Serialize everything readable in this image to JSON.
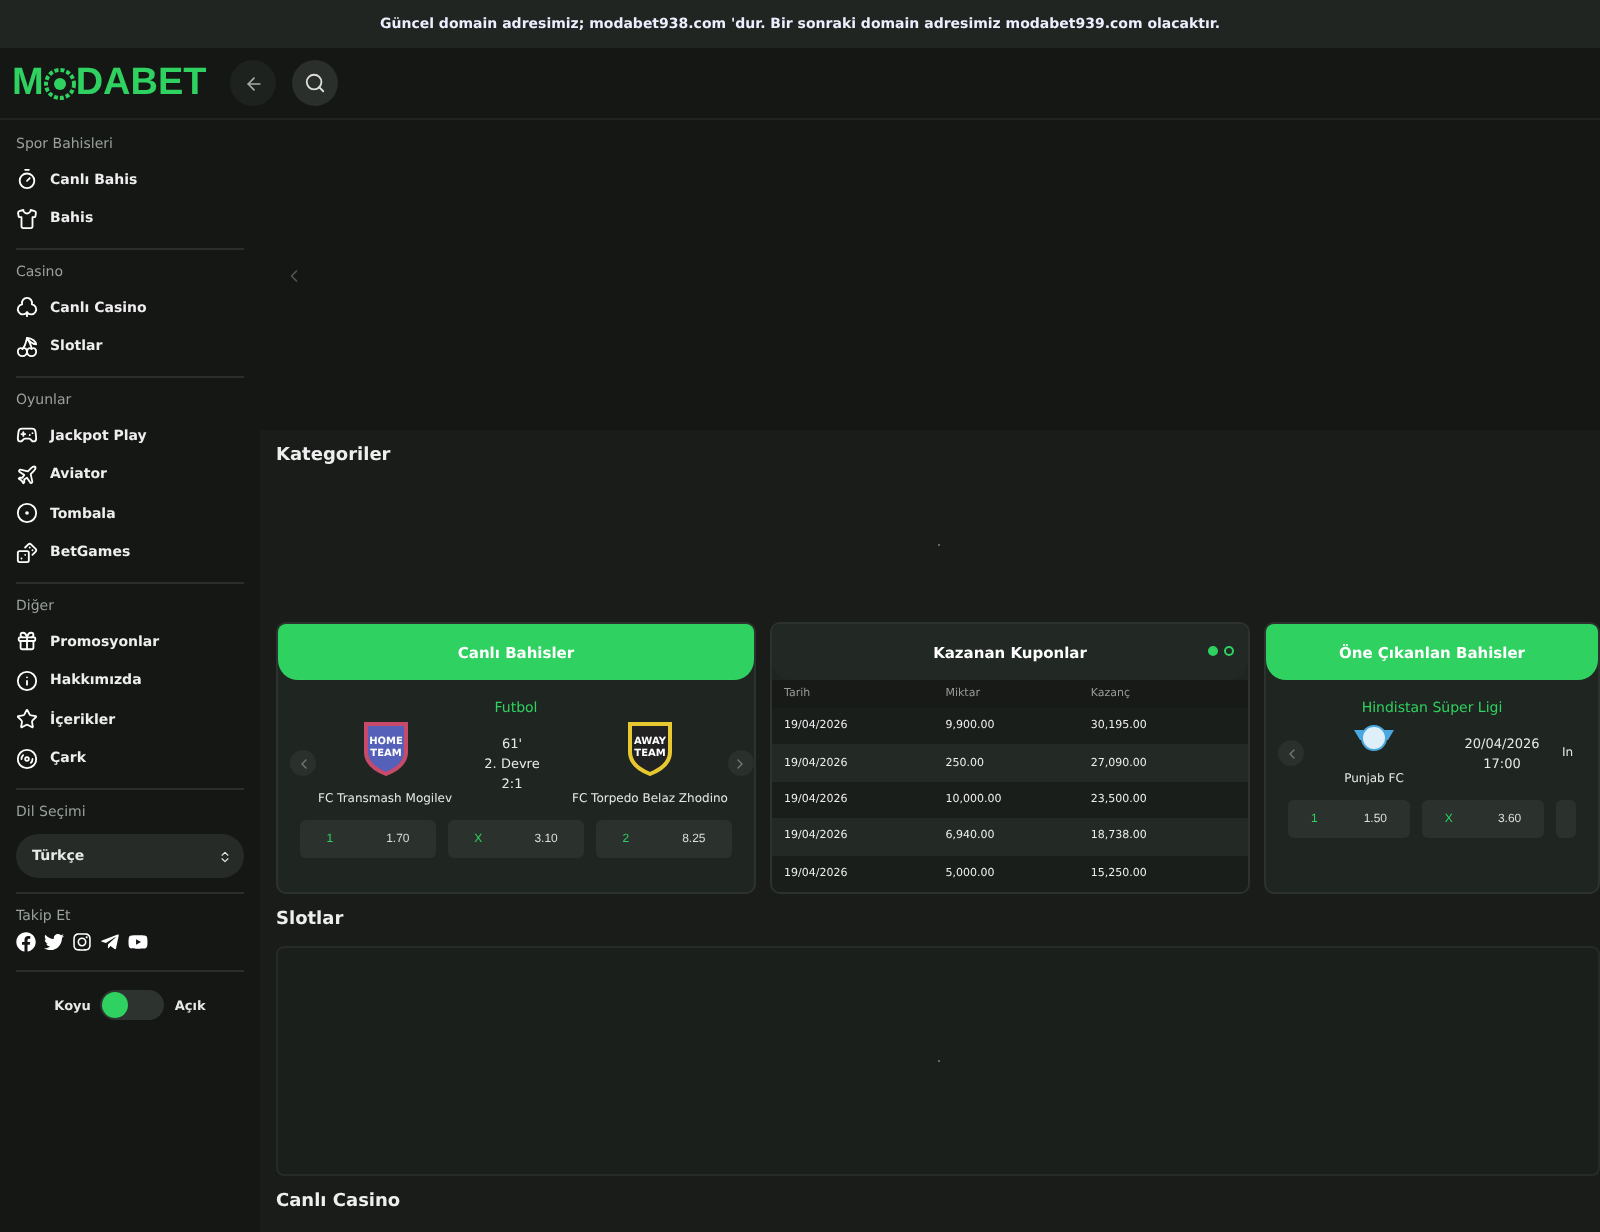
{
  "announcement": "Güncel domain adresimiz; modabet938.com 'dur. Bir sonraki domain adresimiz modabet939.com olacaktır.",
  "logo": {
    "before": "M",
    "after": "DABET"
  },
  "sidebar": {
    "sections": [
      {
        "title": "Spor Bahisleri",
        "items": [
          {
            "label": "Canlı Bahis"
          },
          {
            "label": "Bahis"
          }
        ]
      },
      {
        "title": "Casino",
        "items": [
          {
            "label": "Canlı Casino"
          },
          {
            "label": "Slotlar"
          }
        ]
      },
      {
        "title": "Oyunlar",
        "items": [
          {
            "label": "Jackpot Play"
          },
          {
            "label": "Aviator"
          },
          {
            "label": "Tombala"
          },
          {
            "label": "BetGames"
          }
        ]
      },
      {
        "title": "Diğer",
        "items": [
          {
            "label": "Promosyonlar"
          },
          {
            "label": "Hakkımızda"
          },
          {
            "label": "İçerikler"
          },
          {
            "label": "Çark"
          }
        ]
      }
    ],
    "language": {
      "title": "Dil Seçimi",
      "value": "Türkçe"
    },
    "follow": {
      "title": "Takip Et"
    },
    "theme": {
      "left": "Koyu",
      "right": "Açık",
      "light": false
    }
  },
  "main": {
    "categories_title": "Kategoriler",
    "live_card": {
      "title": "Canlı Bahisler",
      "sport": "Futbol",
      "home": {
        "name": "FC Transmash Mogilev",
        "logo": "HOME TEAM"
      },
      "away": {
        "name": "FC Torpedo Belaz Zhodino",
        "logo": "AWAY TEAM"
      },
      "minute": "61'",
      "period": "2. Devre",
      "score": "2:1",
      "odds": [
        {
          "label": "1",
          "value": "1.70"
        },
        {
          "label": "X",
          "value": "3.10"
        },
        {
          "label": "2",
          "value": "8.25"
        }
      ]
    },
    "coupons_card": {
      "title": "Kazanan Kuponlar",
      "pages": [
        {
          "selected": true
        },
        {
          "selected": false
        }
      ],
      "columns": [
        "Tarih",
        "Miktar",
        "Kazanç"
      ],
      "rows": [
        [
          "19/04/2026",
          "9,900.00",
          "30,195.00"
        ],
        [
          "19/04/2026",
          "250.00",
          "27,090.00"
        ],
        [
          "19/04/2026",
          "10,000.00",
          "23,500.00"
        ],
        [
          "19/04/2026",
          "6,940.00",
          "18,738.00"
        ],
        [
          "19/04/2026",
          "5,000.00",
          "15,250.00"
        ]
      ]
    },
    "featured_card": {
      "title": "Öne Çıkanlan Bahisler",
      "league": "Hindistan Süper Ligi",
      "home": "Punjab FC",
      "date": "20/04/2026",
      "time": "17:00",
      "away": "In",
      "odds": [
        {
          "label": "1",
          "value": "1.50"
        },
        {
          "label": "X",
          "value": "3.60"
        }
      ]
    },
    "slots_title": "Slotlar",
    "casino_title": "Canlı Casino"
  }
}
